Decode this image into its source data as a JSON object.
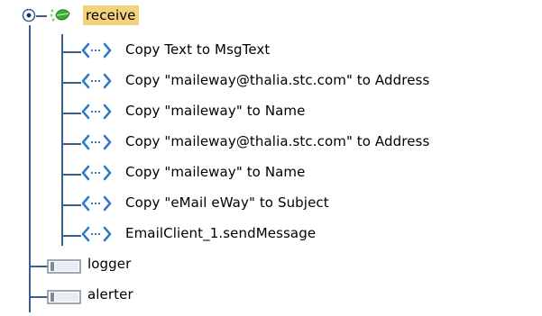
{
  "tree": {
    "root": {
      "label": "receive",
      "icon": "leaf-icon",
      "expanded": true,
      "selected": true
    },
    "operations": [
      {
        "label": "Copy Text to MsgText",
        "icon": "copy-icon"
      },
      {
        "label": "Copy \"maileway@thalia.stc.com\" to Address",
        "icon": "copy-icon"
      },
      {
        "label": "Copy \"maileway\" to Name",
        "icon": "copy-icon"
      },
      {
        "label": "Copy \"maileway@thalia.stc.com\" to Address",
        "icon": "copy-icon"
      },
      {
        "label": "Copy \"maileway\" to Name",
        "icon": "copy-icon"
      },
      {
        "label": "Copy \"eMail eWay\" to Subject",
        "icon": "copy-icon"
      },
      {
        "label": "EmailClient_1.sendMessage",
        "icon": "copy-icon"
      }
    ],
    "siblings": [
      {
        "label": "logger",
        "icon": "component-icon"
      },
      {
        "label": "alerter",
        "icon": "component-icon"
      }
    ]
  },
  "colors": {
    "tree_line": "#3b5f8a",
    "selection": "#f2d27f",
    "copy_icon": "#2f79c7",
    "leaf_green": "#39a935"
  }
}
